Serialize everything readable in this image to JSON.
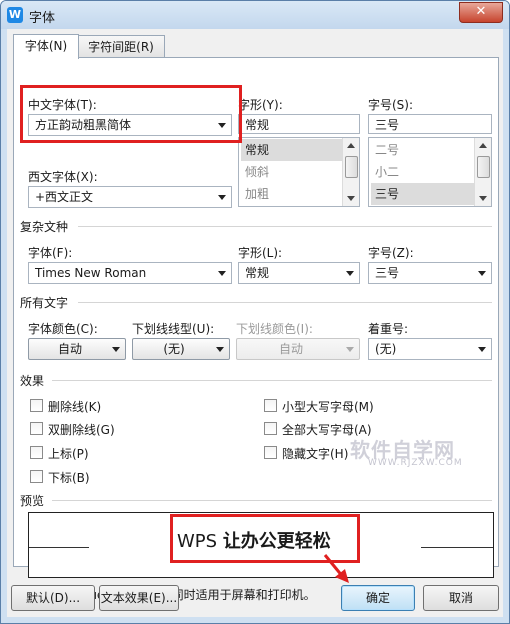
{
  "window": {
    "title": "字体",
    "app_icon": "W",
    "close_glyph": "✕"
  },
  "tabs": [
    {
      "label": "字体(N)",
      "active": true
    },
    {
      "label": "字符间距(R)",
      "active": false
    }
  ],
  "chinese_font": {
    "label": "中文字体(T):",
    "value": "方正韵动粗黑简体"
  },
  "western_font": {
    "label": "西文字体(X):",
    "value": "+西文正文"
  },
  "style": {
    "label": "字形(Y):",
    "value": "常规",
    "options": [
      "常规",
      "倾斜",
      "加粗"
    ],
    "selected_index": 0
  },
  "size": {
    "label": "字号(S):",
    "value": "三号",
    "options": [
      "二号",
      "小二",
      "三号"
    ],
    "selected_index": 2
  },
  "complex_script": {
    "title": "复杂文种",
    "font_label": "字体(F):",
    "font_value": "Times New Roman",
    "style_label": "字形(L):",
    "style_value": "常规",
    "size_label": "字号(Z):",
    "size_value": "三号"
  },
  "all_text": {
    "title": "所有文字",
    "color_label": "字体颜色(C):",
    "color_value": "自动",
    "underline_label": "下划线线型(U):",
    "underline_value": "(无)",
    "underline_color_label": "下划线颜色(I):",
    "underline_color_value": "自动",
    "emphasis_label": "着重号:",
    "emphasis_value": "(无)"
  },
  "effects": {
    "title": "效果",
    "left": [
      "删除线(K)",
      "双删除线(G)",
      "上标(P)",
      "下标(B)"
    ],
    "right": [
      "小型大写字母(M)",
      "全部大写字母(A)",
      "隐藏文字(H)"
    ]
  },
  "preview": {
    "title": "预览",
    "latin": "WPS ",
    "cjk": "让办公更轻松"
  },
  "note": "这是一种 TrueType 字体，同时适用于屏幕和打印机。",
  "buttons": {
    "default": "默认(D)...",
    "text_effects": "文本效果(E)...",
    "ok": "确定",
    "cancel": "取消"
  },
  "watermark": {
    "main": "软件自学网",
    "sub": "WWW.RJZXW.COM"
  },
  "colors": {
    "highlight_border": "#e02020",
    "titlebar": "#cfe0f1"
  }
}
